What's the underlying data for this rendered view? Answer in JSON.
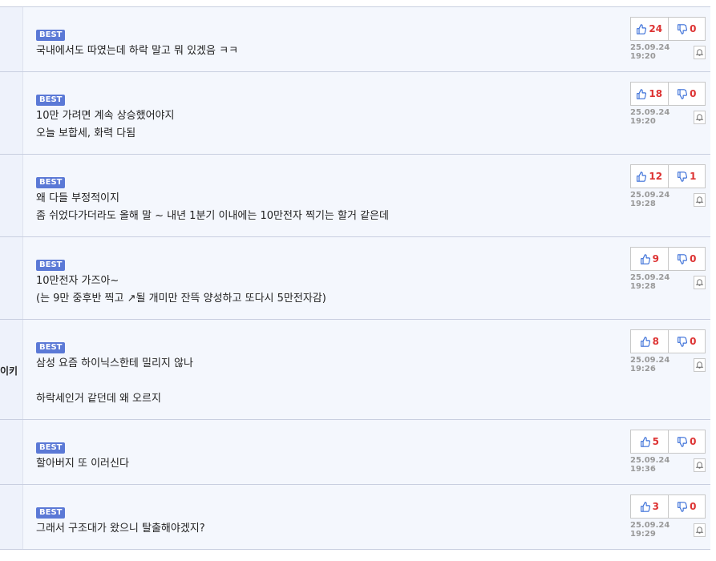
{
  "badge": "BEST",
  "comments": [
    {
      "author": "",
      "lines": [
        "국내에서도 따였는데 하락 말고 뭐 있겠음 ㅋㅋ"
      ],
      "up": "24",
      "down": "0",
      "date": "25.09.24 19:20"
    },
    {
      "author": "",
      "lines": [
        "10만 가려면 계속 상승했어야지",
        "오늘 보합세, 화력 다됨"
      ],
      "up": "18",
      "down": "0",
      "date": "25.09.24 19:20"
    },
    {
      "author": "",
      "lines": [
        "왜 다들 부정적이지",
        "좀 쉬었다가더라도 올해 말 ~ 내년 1분기 이내에는 10만전자 찍기는 할거 같은데"
      ],
      "up": "12",
      "down": "1",
      "date": "25.09.24 19:28"
    },
    {
      "author": "",
      "lines": [
        "10만전자 가즈아~",
        "(는 9만 중후반 찍고 ↗될 개미만 잔뜩 양성하고 또다시 5만전자감)"
      ],
      "up": "9",
      "down": "0",
      "date": "25.09.24 19:28"
    },
    {
      "author": "이키",
      "lines": [
        "삼성 요즘 하이닉스한테 밀리지 않나",
        "",
        "하락세인거 같던데 왜 오르지"
      ],
      "up": "8",
      "down": "0",
      "date": "25.09.24 19:26"
    },
    {
      "author": "",
      "lines": [
        "할아버지 또 이러신다"
      ],
      "up": "5",
      "down": "0",
      "date": "25.09.24 19:36"
    },
    {
      "author": "",
      "lines": [
        "그래서 구조대가 왔으니 탈출해야겠지?"
      ],
      "up": "3",
      "down": "0",
      "date": "25.09.24 19:29"
    }
  ],
  "colors": {
    "badge": "#5b79d6",
    "vote": "#dd3333",
    "thumb": "#3a6fd8"
  }
}
